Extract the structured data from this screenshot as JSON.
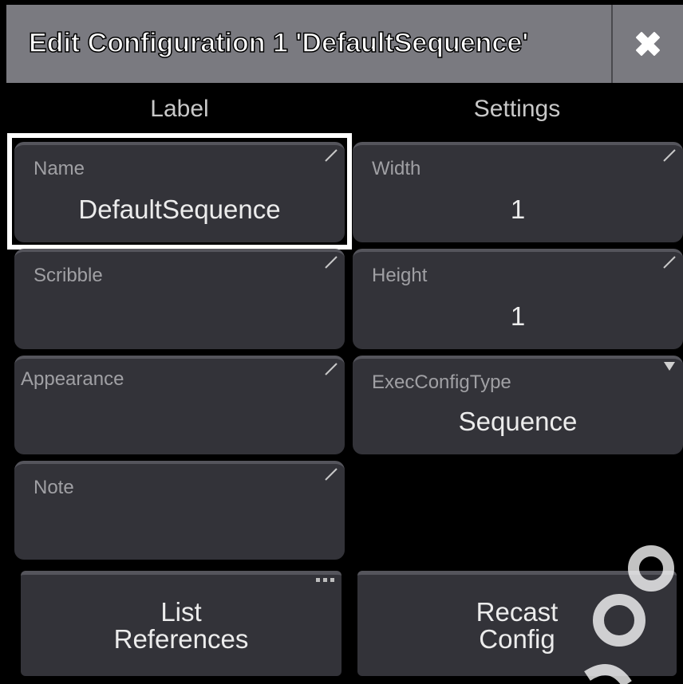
{
  "dialog": {
    "title": "Edit Configuration 1 'DefaultSequence'",
    "close_icon": "close-x-icon"
  },
  "columns": {
    "label": "Label",
    "settings": "Settings"
  },
  "fields": {
    "name": {
      "label": "Name",
      "value": "DefaultSequence"
    },
    "scribble": {
      "label": "Scribble",
      "value": ""
    },
    "appearance": {
      "label": "Appearance",
      "value": ""
    },
    "note": {
      "label": "Note",
      "value": ""
    },
    "width": {
      "label": "Width",
      "value": "1"
    },
    "height": {
      "label": "Height",
      "value": "1"
    },
    "exec_config_type": {
      "label": "ExecConfigType",
      "value": "Sequence"
    }
  },
  "buttons": {
    "list_references": "List\nReferences",
    "recast_config": "Recast\nConfig"
  },
  "colors": {
    "background": "#000000",
    "titlebar": "#7a7a80",
    "field": "#333339",
    "selection": "#ffffff"
  }
}
